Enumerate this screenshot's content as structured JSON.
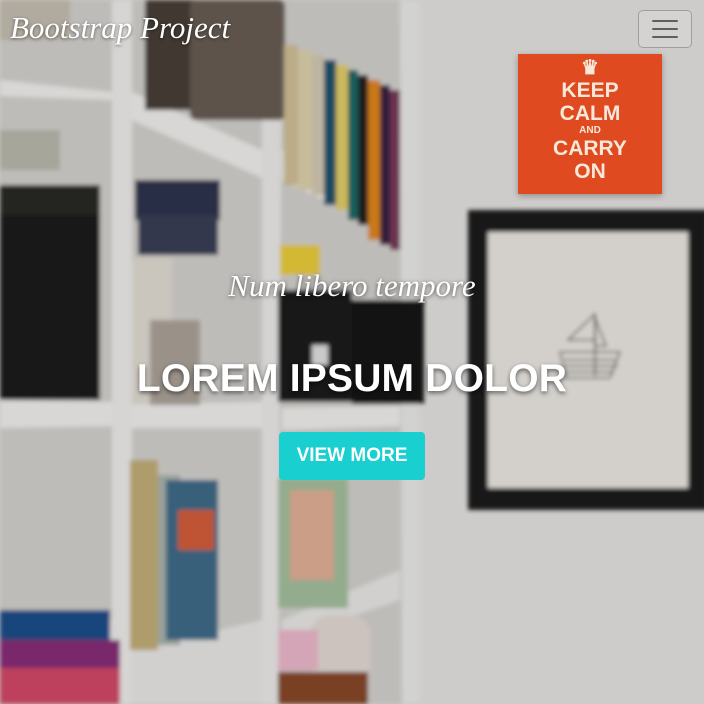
{
  "navbar": {
    "brand": "Bootstrap Project",
    "toggler_icon": "hamburger-icon"
  },
  "hero": {
    "subtitle": "Num libero tempore",
    "title": "LOREM IPSUM DOLOR",
    "cta_label": "VIEW MORE",
    "accent_color": "#19cfcf"
  },
  "poster": {
    "lines": [
      "KEEP",
      "CALM",
      "AND",
      "CARRY",
      "ON"
    ],
    "icon": "crown-icon",
    "color": "#e04a20"
  }
}
